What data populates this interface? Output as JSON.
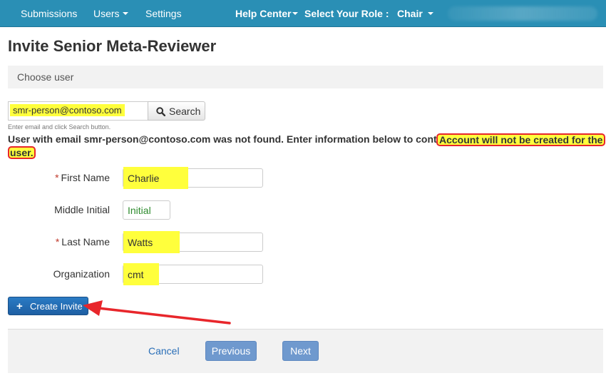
{
  "nav": {
    "submissions": "Submissions",
    "users": "Users",
    "settings": "Settings",
    "help_center": "Help Center",
    "role_label": "Select Your Role :",
    "role_value": "Chair"
  },
  "page": {
    "title": "Invite Senior Meta-Reviewer",
    "section": "Choose user"
  },
  "search": {
    "value": "smr-person@contoso.com",
    "button": "Search",
    "hint": "Enter email and click Search button."
  },
  "message": {
    "main": "User with email smr-person@contoso.com was not found. Enter information below to continue.",
    "warning_line1": "Account will not be created for the",
    "warning_line2": "user."
  },
  "form": {
    "required_mark": "*",
    "first_name_label": "First Name",
    "first_name_value": "Charlie",
    "middle_initial_label": "Middle Initial",
    "middle_initial_placeholder": "Initial",
    "last_name_label": "Last Name",
    "last_name_value": "Watts",
    "organization_label": "Organization",
    "organization_value": "cmt"
  },
  "actions": {
    "create_invite": "Create Invite",
    "cancel": "Cancel",
    "previous": "Previous",
    "next": "Next"
  },
  "colors": {
    "nav_bg": "#2a8fb5",
    "highlight": "#ffff3c",
    "annotation_red": "#e8262b",
    "primary_button": "#1e5fa3",
    "nav_button": "#6f99ce"
  },
  "icons": {
    "search": "magnifier-icon",
    "create": "plus-icon",
    "dropdown": "caret-down-icon",
    "annotation": "red-arrow-icon"
  }
}
